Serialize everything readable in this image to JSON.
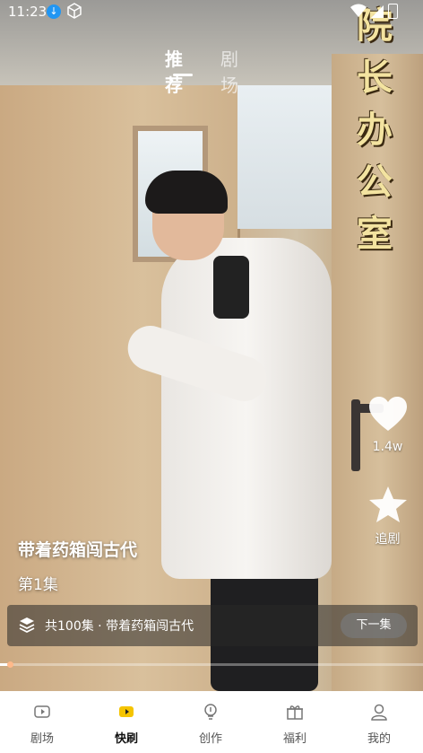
{
  "status_bar": {
    "time": "11:23"
  },
  "top_tabs": [
    {
      "label": "推荐",
      "active": true
    },
    {
      "label": "剧场",
      "active": false
    }
  ],
  "overlay_title": [
    "院",
    "长",
    "办",
    "公",
    "室"
  ],
  "actions": {
    "like_count": "1.4w",
    "favorite_label": "追剧"
  },
  "drama": {
    "title": "带着药箱闯古代",
    "episode": "第1集",
    "series_info": "共100集 · 带着药箱闯古代",
    "next_label": "下一集"
  },
  "progress": {
    "fraction": 0.02
  },
  "bottom_nav": [
    {
      "label": "剧场",
      "icon": "video-icon",
      "active": false
    },
    {
      "label": "快刷",
      "icon": "play-icon",
      "active": true
    },
    {
      "label": "创作",
      "icon": "bulb-icon",
      "active": false
    },
    {
      "label": "福利",
      "icon": "gift-icon",
      "active": false
    },
    {
      "label": "我的",
      "icon": "person-icon",
      "active": false
    }
  ],
  "colors": {
    "accent": "#f5c400",
    "background": "#ffffff"
  }
}
